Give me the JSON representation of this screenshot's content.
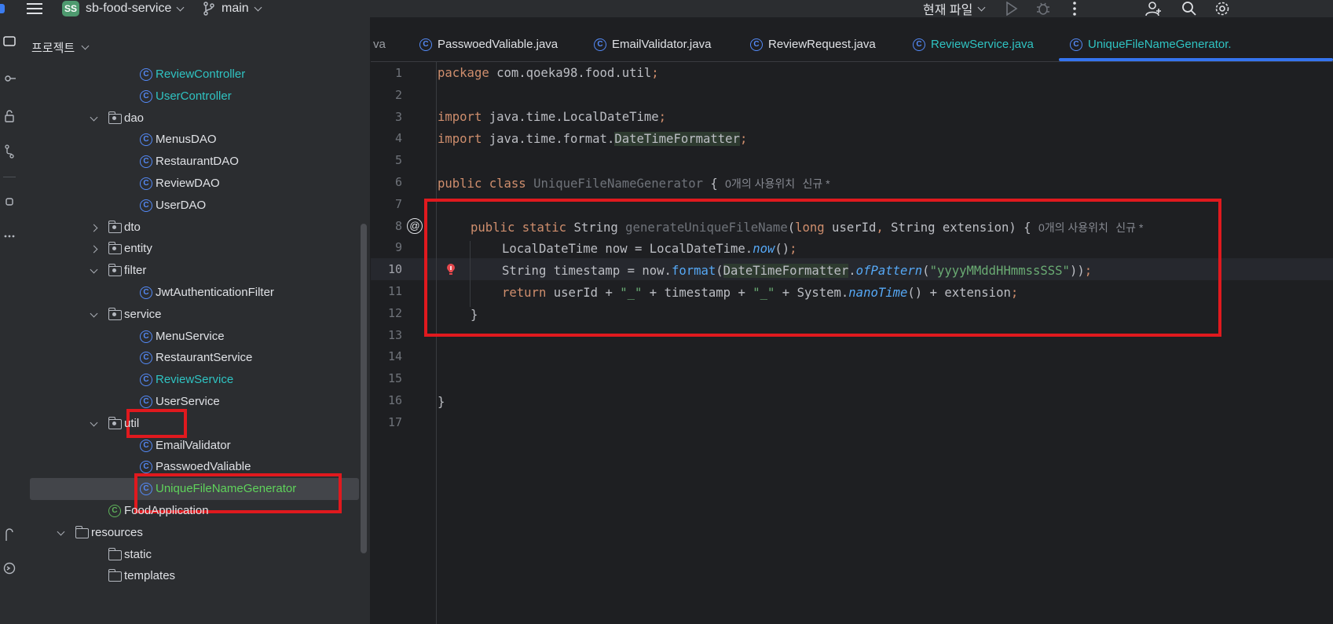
{
  "topbar": {
    "project_badge": "SS",
    "project_name": "sb-food-service",
    "branch": "main",
    "run_config": "현재 파일"
  },
  "project_panel": {
    "title": "프로젝트",
    "items": [
      {
        "label": "ReviewController",
        "type": "class",
        "depth": 3,
        "color": "cyan"
      },
      {
        "label": "UserController",
        "type": "class",
        "depth": 3,
        "color": "cyan"
      },
      {
        "label": "dao",
        "type": "package",
        "depth": 2,
        "expanded": true
      },
      {
        "label": "MenusDAO",
        "type": "class",
        "depth": 3
      },
      {
        "label": "RestaurantDAO",
        "type": "class",
        "depth": 3
      },
      {
        "label": "ReviewDAO",
        "type": "class",
        "depth": 3
      },
      {
        "label": "UserDAO",
        "type": "class",
        "depth": 3
      },
      {
        "label": "dto",
        "type": "package",
        "depth": 2,
        "expanded": false
      },
      {
        "label": "entity",
        "type": "package",
        "depth": 2,
        "expanded": false
      },
      {
        "label": "filter",
        "type": "package",
        "depth": 2,
        "expanded": true
      },
      {
        "label": "JwtAuthenticationFilter",
        "type": "class",
        "depth": 3
      },
      {
        "label": "service",
        "type": "package",
        "depth": 2,
        "expanded": true
      },
      {
        "label": "MenuService",
        "type": "class",
        "depth": 3
      },
      {
        "label": "RestaurantService",
        "type": "class",
        "depth": 3
      },
      {
        "label": "ReviewService",
        "type": "class",
        "depth": 3,
        "color": "cyan"
      },
      {
        "label": "UserService",
        "type": "class",
        "depth": 3
      },
      {
        "label": "util",
        "type": "package",
        "depth": 2,
        "expanded": true
      },
      {
        "label": "EmailValidator",
        "type": "class",
        "depth": 3
      },
      {
        "label": "PasswoedValiable",
        "type": "class",
        "depth": 3
      },
      {
        "label": "UniqueFileNameGenerator",
        "type": "class",
        "depth": 3,
        "color": "green",
        "selected": true
      },
      {
        "label": "FoodApplication",
        "type": "app",
        "depth": 2
      },
      {
        "label": "resources",
        "type": "resources",
        "depth": 1,
        "expanded": true
      },
      {
        "label": "static",
        "type": "folder",
        "depth": 2
      },
      {
        "label": "templates",
        "type": "folder",
        "depth": 2
      }
    ]
  },
  "tabs": [
    {
      "label": "va",
      "icon": false
    },
    {
      "label": "PasswoedValiable.java",
      "icon": true
    },
    {
      "label": "EmailValidator.java",
      "icon": true
    },
    {
      "label": "ReviewRequest.java",
      "icon": true
    },
    {
      "label": "ReviewService.java",
      "icon": true,
      "color": "cyan"
    },
    {
      "label": "UniqueFileNameGenerator.",
      "icon": true,
      "color": "cyan",
      "active": true
    }
  ],
  "editor": {
    "line_numbers": [
      "1",
      "2",
      "3",
      "4",
      "5",
      "6",
      "7",
      "8",
      "9",
      "10",
      "11",
      "12",
      "13",
      "14",
      "15",
      "16",
      "17"
    ],
    "current_line": "10",
    "hints": {
      "class_usages": "0개의 사용위치",
      "class_new": "신규 *",
      "method_usages": "0개의 사용위치",
      "method_new": "신규 *"
    },
    "gutter_marker": "@"
  }
}
